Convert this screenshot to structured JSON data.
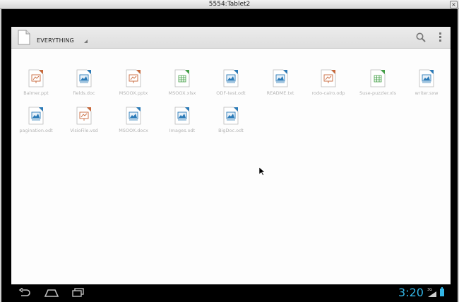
{
  "window": {
    "title": "5554:Tablet2",
    "close_glyph": "×"
  },
  "actionbar": {
    "filter_label": "EVERYTHING",
    "search_icon": "search-icon",
    "overflow_icon": "overflow-menu-icon"
  },
  "files": [
    {
      "name": "Balmer.ppt",
      "type": "presentation"
    },
    {
      "name": "fields.doc",
      "type": "text"
    },
    {
      "name": "MSOOX.pptx",
      "type": "presentation"
    },
    {
      "name": "MSOOX.xlsx",
      "type": "spreadsheet"
    },
    {
      "name": "ODF-test.odt",
      "type": "text"
    },
    {
      "name": "README.txt",
      "type": "text"
    },
    {
      "name": "rodo-cairo.odp",
      "type": "presentation"
    },
    {
      "name": "Suse-puzzler.xls",
      "type": "spreadsheet"
    },
    {
      "name": "writer.sxw",
      "type": "text"
    },
    {
      "name": "pagination.odt",
      "type": "text"
    },
    {
      "name": "VisioFile.vsd",
      "type": "drawing"
    },
    {
      "name": "MSOOX.docx",
      "type": "text"
    },
    {
      "name": "Images.odt",
      "type": "text"
    },
    {
      "name": "BigDoc.odt",
      "type": "text"
    }
  ],
  "colors": {
    "text": "#2a7ab8",
    "presentation": "#c8683a",
    "spreadsheet": "#43a047",
    "drawing": "#c8683a",
    "accent": "#33b5e5"
  },
  "status": {
    "clock": "3:20",
    "network": "3G"
  },
  "nav": {
    "back": "back-icon",
    "home": "home-icon",
    "recents": "recent-apps-icon"
  }
}
